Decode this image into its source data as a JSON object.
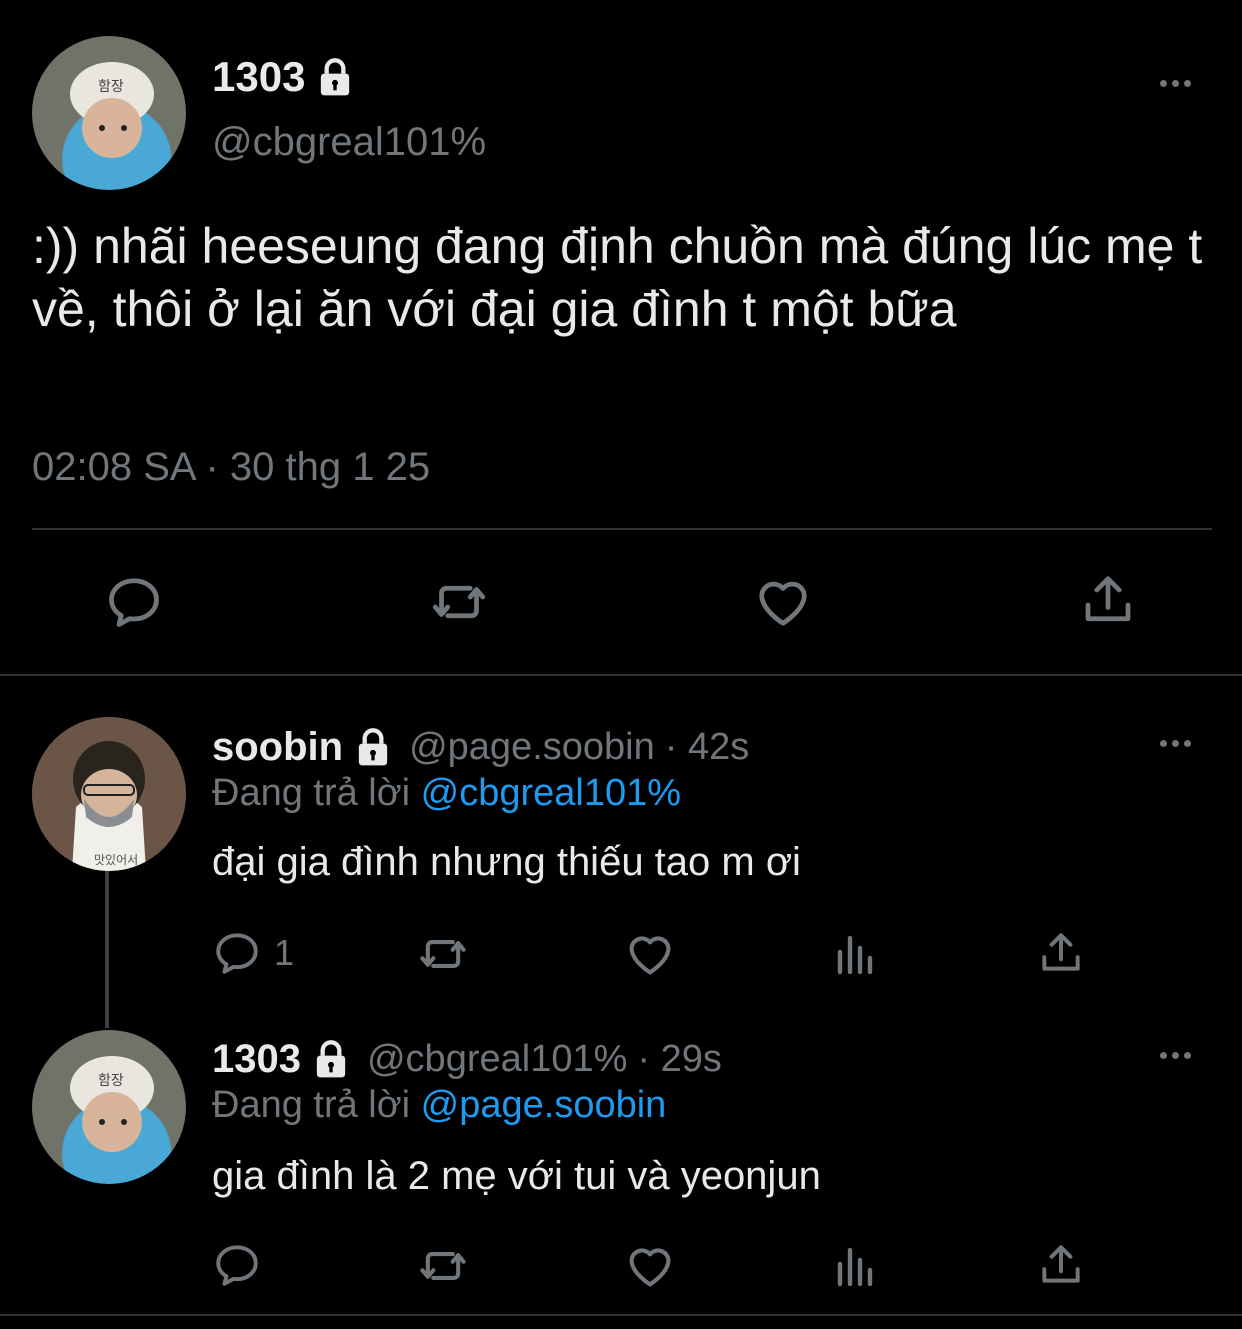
{
  "main_tweet": {
    "display_name": "1303",
    "handle": "@cbgreal101%",
    "text": ":)) nhãi heeseung đang định chuồn mà đúng lúc mẹ t về, thôi ở lại ăn với đại gia đình t một bữa",
    "timestamp": "02:08 SA · 30 thg 1 25",
    "avatar_text": "함장",
    "icons": [
      "reply-icon",
      "retweet-icon",
      "like-icon",
      "share-icon"
    ]
  },
  "replies": [
    {
      "display_name": "soobin",
      "handle": "@page.soobin",
      "time": "· 42s",
      "replying_label": "Đang trả lời",
      "replying_to": "@cbgreal101%",
      "text": "đại gia đình nhưng thiếu tao m ơi",
      "reply_count": "1",
      "avatar_text": "맛있어서"
    },
    {
      "display_name": "1303",
      "handle": "@cbgreal101%",
      "time": "· 29s",
      "replying_label": "Đang trả lời",
      "replying_to": "@page.soobin",
      "text": "gia đình là 2 mẹ với tui và yeonjun",
      "reply_count": "",
      "avatar_text": "함장"
    }
  ],
  "colors": {
    "background": "#000000",
    "text": "#e7e9ea",
    "muted": "#71767b",
    "link": "#1d9bf0",
    "divider": "#2f3336"
  }
}
